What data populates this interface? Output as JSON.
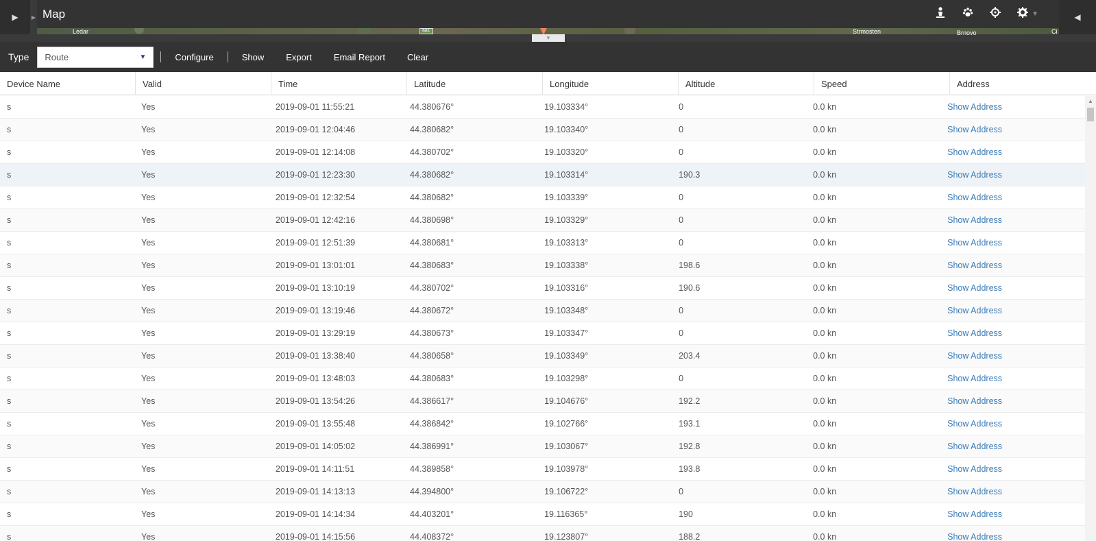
{
  "map": {
    "title": "Map",
    "labels": [
      "Ledar",
      "681",
      "Strmosten",
      "Brnovo",
      "Ci"
    ],
    "tools": [
      "person-icon",
      "paw-icon",
      "crosshair-icon",
      "gear-icon"
    ]
  },
  "toolbar": {
    "type_label": "Type",
    "type_value": "Route",
    "configure": "Configure",
    "show": "Show",
    "export": "Export",
    "email_report": "Email Report",
    "clear": "Clear"
  },
  "grid": {
    "columns": [
      "Device Name",
      "Valid",
      "Time",
      "Latitude",
      "Longitude",
      "Altitude",
      "Speed",
      "Address"
    ],
    "selected_row": 3,
    "rows": [
      [
        "s",
        "Yes",
        "2019-09-01 11:55:21",
        "44.380676°",
        "19.103334°",
        "0",
        "0.0 kn",
        "Show Address"
      ],
      [
        "s",
        "Yes",
        "2019-09-01 12:04:46",
        "44.380682°",
        "19.103340°",
        "0",
        "0.0 kn",
        "Show Address"
      ],
      [
        "s",
        "Yes",
        "2019-09-01 12:14:08",
        "44.380702°",
        "19.103320°",
        "0",
        "0.0 kn",
        "Show Address"
      ],
      [
        "s",
        "Yes",
        "2019-09-01 12:23:30",
        "44.380682°",
        "19.103314°",
        "190.3",
        "0.0 kn",
        "Show Address"
      ],
      [
        "s",
        "Yes",
        "2019-09-01 12:32:54",
        "44.380682°",
        "19.103339°",
        "0",
        "0.0 kn",
        "Show Address"
      ],
      [
        "s",
        "Yes",
        "2019-09-01 12:42:16",
        "44.380698°",
        "19.103329°",
        "0",
        "0.0 kn",
        "Show Address"
      ],
      [
        "s",
        "Yes",
        "2019-09-01 12:51:39",
        "44.380681°",
        "19.103313°",
        "0",
        "0.0 kn",
        "Show Address"
      ],
      [
        "s",
        "Yes",
        "2019-09-01 13:01:01",
        "44.380683°",
        "19.103338°",
        "198.6",
        "0.0 kn",
        "Show Address"
      ],
      [
        "s",
        "Yes",
        "2019-09-01 13:10:19",
        "44.380702°",
        "19.103316°",
        "190.6",
        "0.0 kn",
        "Show Address"
      ],
      [
        "s",
        "Yes",
        "2019-09-01 13:19:46",
        "44.380672°",
        "19.103348°",
        "0",
        "0.0 kn",
        "Show Address"
      ],
      [
        "s",
        "Yes",
        "2019-09-01 13:29:19",
        "44.380673°",
        "19.103347°",
        "0",
        "0.0 kn",
        "Show Address"
      ],
      [
        "s",
        "Yes",
        "2019-09-01 13:38:40",
        "44.380658°",
        "19.103349°",
        "203.4",
        "0.0 kn",
        "Show Address"
      ],
      [
        "s",
        "Yes",
        "2019-09-01 13:48:03",
        "44.380683°",
        "19.103298°",
        "0",
        "0.0 kn",
        "Show Address"
      ],
      [
        "s",
        "Yes",
        "2019-09-01 13:54:26",
        "44.386617°",
        "19.104676°",
        "192.2",
        "0.0 kn",
        "Show Address"
      ],
      [
        "s",
        "Yes",
        "2019-09-01 13:55:48",
        "44.386842°",
        "19.102766°",
        "193.1",
        "0.0 kn",
        "Show Address"
      ],
      [
        "s",
        "Yes",
        "2019-09-01 14:05:02",
        "44.386991°",
        "19.103067°",
        "192.8",
        "0.0 kn",
        "Show Address"
      ],
      [
        "s",
        "Yes",
        "2019-09-01 14:11:51",
        "44.389858°",
        "19.103978°",
        "193.8",
        "0.0 kn",
        "Show Address"
      ],
      [
        "s",
        "Yes",
        "2019-09-01 14:13:13",
        "44.394800°",
        "19.106722°",
        "0",
        "0.0 kn",
        "Show Address"
      ],
      [
        "s",
        "Yes",
        "2019-09-01 14:14:34",
        "44.403201°",
        "19.116365°",
        "190",
        "0.0 kn",
        "Show Address"
      ],
      [
        "s",
        "Yes",
        "2019-09-01 14:15:56",
        "44.408372°",
        "19.123807°",
        "188.2",
        "0.0 kn",
        "Show Address"
      ]
    ]
  }
}
